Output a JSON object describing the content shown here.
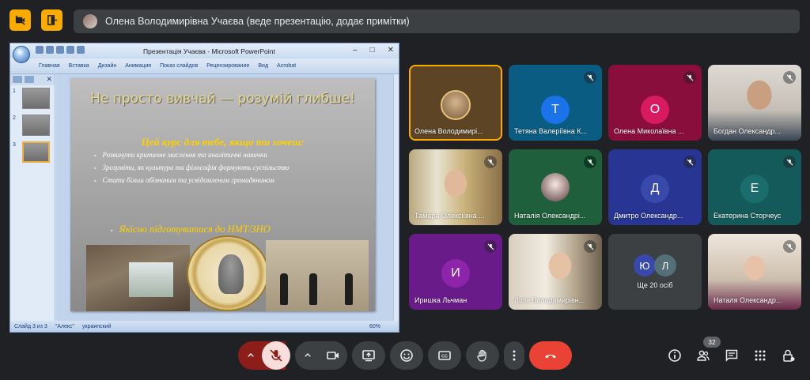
{
  "presenter_banner": "Олена Володимирівна Учаєва (веде презентацію, додає примітки)",
  "powerpoint": {
    "window_title": "Презентація Учаєва - Microsoft PowerPoint",
    "ribbon_tabs": [
      "Главная",
      "Вставка",
      "Дизайн",
      "Анимация",
      "Показ слайдов",
      "Рецензирование",
      "Вид",
      "Acrobat"
    ],
    "thumbnail_numbers": [
      "1",
      "2",
      "3"
    ],
    "slide": {
      "heading": "Не просто вивчай — розумій глибше!",
      "subheading": "Цей курс для тебе, якщо ти хочеш:",
      "bullets": [
        "Розвинути критичне мислення та аналітичні навички",
        "Зрозуміти, як культура та філософія формують суспільство",
        "Стати більш обізнаним та усвідомленим громадянином"
      ],
      "goal": "Якісно підготуватися до НМТ/ЗНО"
    },
    "status": {
      "slide_info": "Слайд 3 из 3",
      "theme": "\"Алекс\"",
      "language": "украинский",
      "zoom": "60%"
    }
  },
  "participants": [
    {
      "name": "Олена Володимирі...",
      "initial": "",
      "muted": false,
      "speaking": true
    },
    {
      "name": "Тетяна Валеріївна К...",
      "initial": "Т",
      "muted": true
    },
    {
      "name": "Олена Миколаївна ...",
      "initial": "О",
      "muted": true
    },
    {
      "name": "Богдан Олександр...",
      "initial": "",
      "muted": true
    },
    {
      "name": "Тамара Олексіївна ...",
      "initial": "",
      "muted": true
    },
    {
      "name": "Наталія Олександрі...",
      "initial": "",
      "muted": false
    },
    {
      "name": "Дмитро Олександр...",
      "initial": "Д",
      "muted": true
    },
    {
      "name": "Екатерина Сторчеус",
      "initial": "Е",
      "muted": true
    },
    {
      "name": "Иришка Льчман",
      "initial": "И",
      "muted": true
    },
    {
      "name": "Лілія Володимирівн...",
      "initial": "",
      "muted": true
    },
    {
      "name": "Наталя Олександр...",
      "initial": "",
      "muted": true
    }
  ],
  "more_tile": {
    "initials": [
      "Ю",
      "Л"
    ],
    "label": "Ще 20 осіб"
  },
  "participant_count": "32",
  "colors": {
    "accent": "#f9ab00",
    "end_call": "#ea4335",
    "muted_mic_bg": "#f9dedc"
  }
}
